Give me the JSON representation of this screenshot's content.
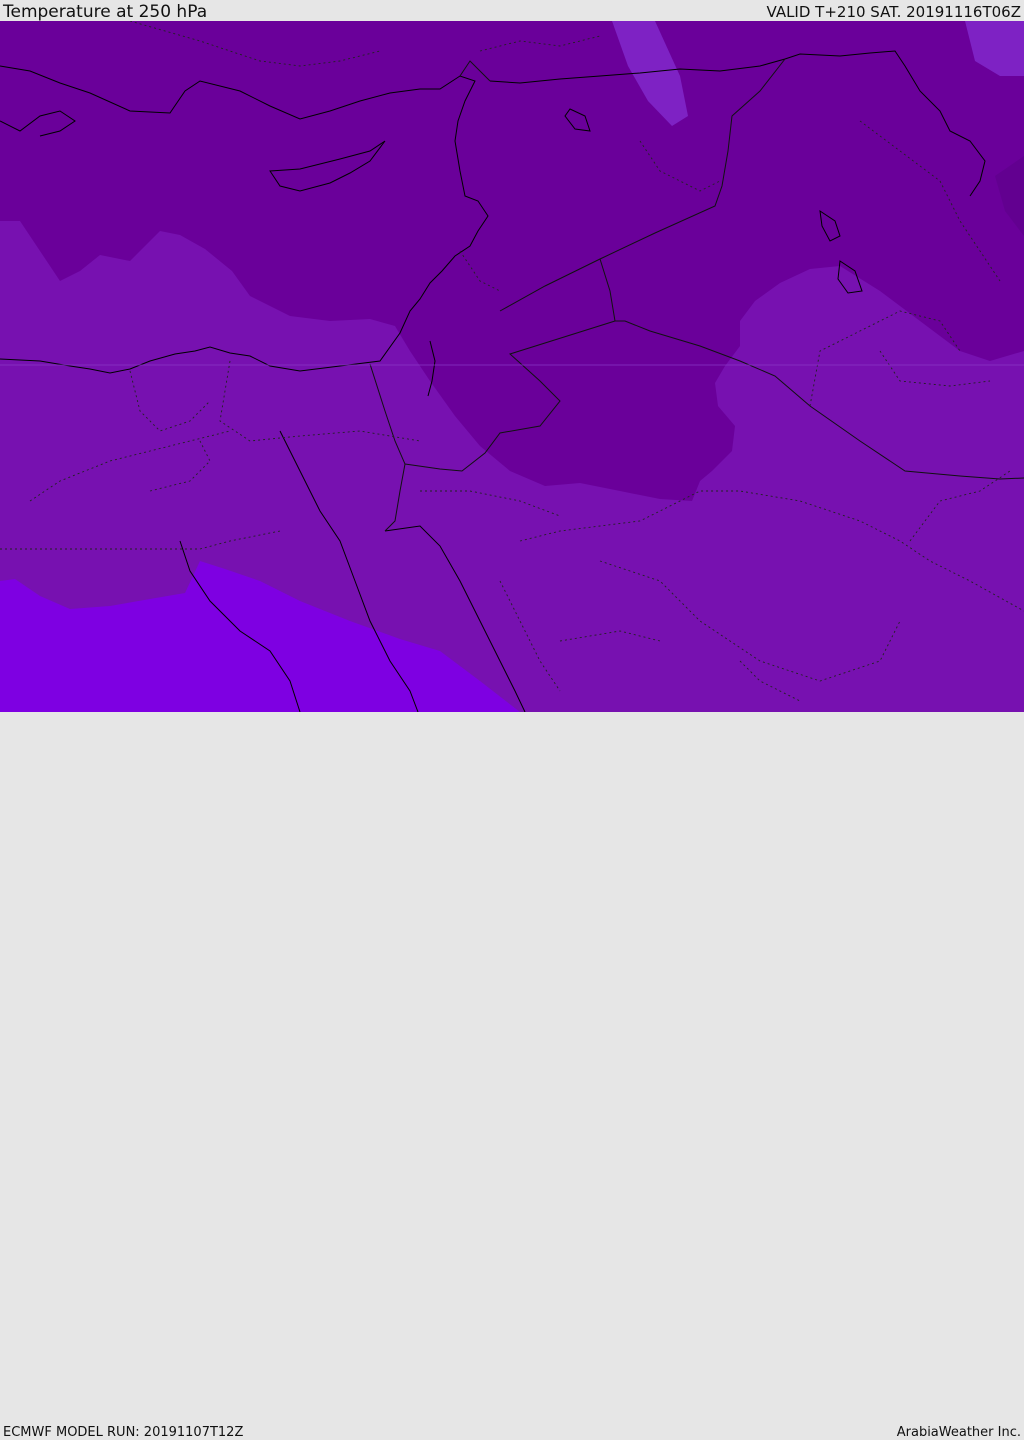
{
  "header": {
    "title": "Temperature at 250 hPa",
    "valid_time": "VALID T+210 SAT. 20191116T06Z"
  },
  "footer": {
    "model_run": "ECMWF MODEL RUN: 20191107T12Z",
    "credit": "ArabiaWeather Inc."
  },
  "colors": {
    "band_dark": "#6a009a",
    "band_darker": "#620090",
    "band_mid": "#7711b0",
    "band_light": "#7e00e2",
    "band_pale": "#7e22c4",
    "coastline": "#000000",
    "border": "#111111"
  }
}
